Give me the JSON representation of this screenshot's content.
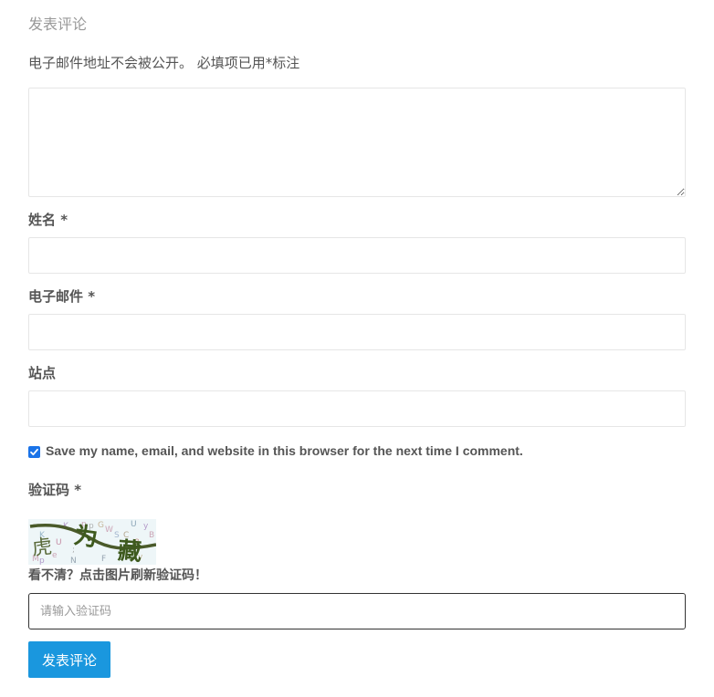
{
  "form": {
    "heading": "发表评论",
    "notes": "电子邮件地址不会被公开。 必填项已用*标注",
    "fields": {
      "name_label": "姓名 *",
      "email_label": "电子邮件 *",
      "url_label": "站点"
    },
    "cookies_consent": {
      "checked": true,
      "label": "Save my name, email, and website in this browser for the next time I comment."
    },
    "captcha": {
      "label": "验证码 *",
      "image_chars": [
        "虎",
        "为",
        "藏"
      ],
      "hint": "看不清？点击图片刷新验证码！",
      "placeholder": "请输入验证码"
    },
    "submit_label": "发表评论"
  },
  "colors": {
    "accent": "#1a97de",
    "checkbox": "#1a73e8",
    "heading": "#999999",
    "text": "#555555",
    "border": "#e6e6e6"
  }
}
